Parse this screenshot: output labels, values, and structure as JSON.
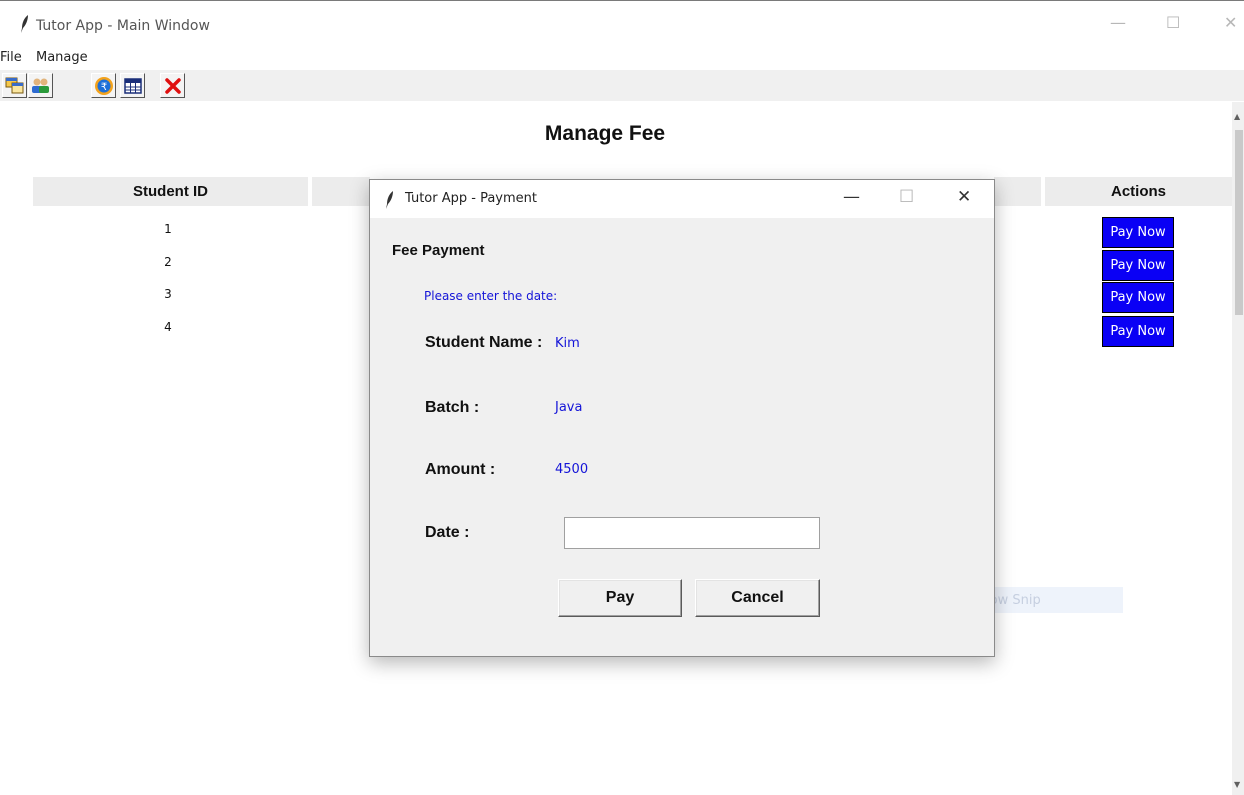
{
  "main_window": {
    "title": "Tutor App - Main Window",
    "controls": {
      "minimize": "—",
      "maximize": "☐",
      "close": "✕"
    }
  },
  "menu": {
    "items": [
      "File",
      "Manage"
    ]
  },
  "toolbar": {
    "buttons": [
      {
        "icon": "copy-windows-icon"
      },
      {
        "icon": "users-icon"
      },
      {
        "icon": "rupee-coin-icon"
      },
      {
        "icon": "table-icon"
      },
      {
        "icon": "red-x-icon"
      }
    ]
  },
  "page": {
    "title": "Manage Fee",
    "columns": {
      "student_id": "Student ID",
      "actions": "Actions"
    },
    "rows": [
      {
        "id": "1",
        "action": "Pay Now"
      },
      {
        "id": "2",
        "action": "Pay Now"
      },
      {
        "id": "3",
        "action": "Pay Now"
      },
      {
        "id": "4",
        "action": "Pay Now"
      }
    ]
  },
  "overlay": {
    "snip_label": "Window Snip"
  },
  "dialog": {
    "title": "Tutor App - Payment",
    "controls": {
      "minimize": "—",
      "maximize": "☐",
      "close": "✕"
    },
    "heading": "Fee Payment",
    "instruction": "Please enter the date:",
    "fields": {
      "student_name_label": "Student Name :",
      "student_name_value": "Kim",
      "batch_label": "Batch :",
      "batch_value": "Java",
      "amount_label": "Amount :",
      "amount_value": "4500",
      "date_label": "Date :",
      "date_value": ""
    },
    "buttons": {
      "pay": "Pay",
      "cancel": "Cancel"
    }
  },
  "colors": {
    "pay_now_bg": "#0a00f5",
    "value_text": "#1414d8",
    "header_bg": "#ececec",
    "dialog_bg": "#f0f0f0"
  }
}
